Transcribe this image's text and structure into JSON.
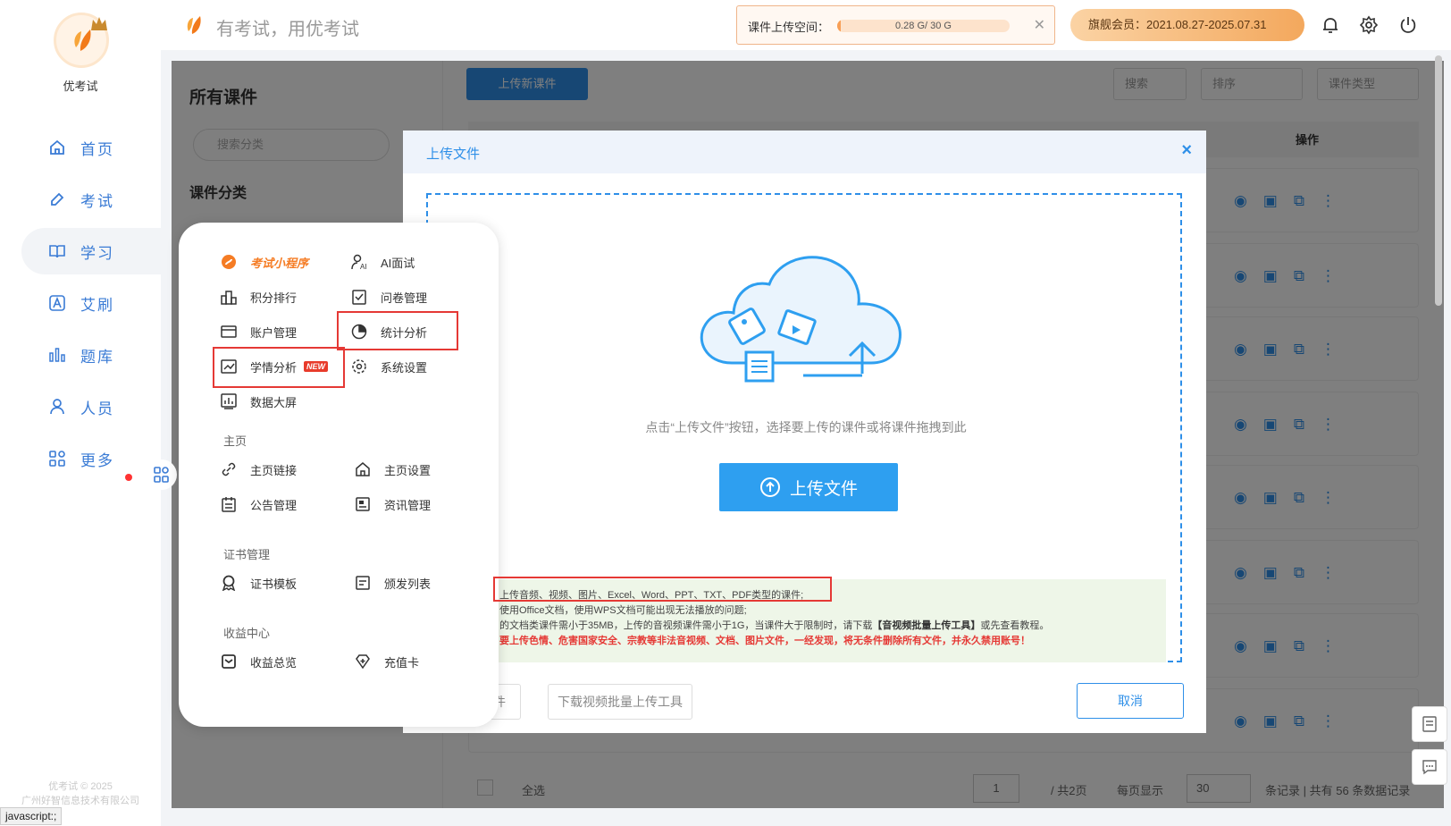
{
  "app": {
    "name": "优考试",
    "slogan": "有考试，用优考试"
  },
  "nav": [
    {
      "label": "首页",
      "icon": "home-icon"
    },
    {
      "label": "考试",
      "icon": "edit-icon"
    },
    {
      "label": "学习",
      "icon": "book-icon"
    },
    {
      "label": "艾刷",
      "icon": "letter-a-icon"
    },
    {
      "label": "题库",
      "icon": "bar-chart-icon"
    },
    {
      "label": "人员",
      "icon": "person-icon"
    },
    {
      "label": "更多",
      "icon": "grid-icon"
    }
  ],
  "footer": {
    "copyright": "优考试 © 2025",
    "company": "广州好智信息技术有限公司"
  },
  "status_url": "javascript:;",
  "storage": {
    "label": "课件上传空间：",
    "value": "0.28 G/ 30 G",
    "used_fraction": 0.0093
  },
  "vip": {
    "label": "旗舰会员：2021.08.27-2025.07.31"
  },
  "courseware": {
    "title": "所有课件",
    "search_placeholder": "搜索分类",
    "category_title": "课件分类",
    "upload_new": "上传新课件",
    "search": "搜索",
    "sort": "排序",
    "type": "课件类型",
    "op_header": "操作"
  },
  "pager": {
    "select_all": "全选",
    "page": "1",
    "total_pages": "/ 共2页",
    "per_page_label": "每页显示",
    "per_page": "30",
    "summary": "条记录 | 共有 56 条数据记录"
  },
  "menu": {
    "items": [
      {
        "label": "考试小程序"
      },
      {
        "label": "AI面试"
      },
      {
        "label": "积分排行"
      },
      {
        "label": "问卷管理"
      },
      {
        "label": "账户管理"
      },
      {
        "label": "统计分析"
      },
      {
        "label": "学情分析",
        "badge": "NEW"
      },
      {
        "label": "系统设置"
      },
      {
        "label": "数据大屏"
      }
    ],
    "sections": [
      {
        "title": "主页",
        "items": [
          {
            "label": "主页链接"
          },
          {
            "label": "主页设置"
          },
          {
            "label": "公告管理"
          },
          {
            "label": "资讯管理"
          }
        ]
      },
      {
        "title": "证书管理",
        "items": [
          {
            "label": "证书模板"
          },
          {
            "label": "颁发列表"
          }
        ]
      },
      {
        "title": "收益中心",
        "items": [
          {
            "label": "收益总览"
          },
          {
            "label": "充值卡"
          }
        ]
      }
    ]
  },
  "modal": {
    "title": "上传文件",
    "close": "×",
    "hint": "点击“上传文件”按钮，选择要上传的课件或将课件拖拽到此",
    "upload_button": "上传文件",
    "notes": [
      "上传音频、视频、图片、Excel、Word、PPT、TXT、PDF类型的课件;",
      "使用Office文档，使用WPS文档可能出现无法播放的问题;",
      "的文档类课件需小于35MB，上传的音视频课件需小于1G，当课件大于限制时，请下载",
      "【音视频批量上传工具】",
      "或先查看教程。",
      "要上传色情、危害国家安全、宗教等非法音视频、文档、图片文件，一经发现，将无条件删除所有文件，并永久禁用账号！"
    ],
    "btn_partial": "件",
    "btn_download_tool": "下载视频批量上传工具",
    "btn_cancel": "取消"
  }
}
